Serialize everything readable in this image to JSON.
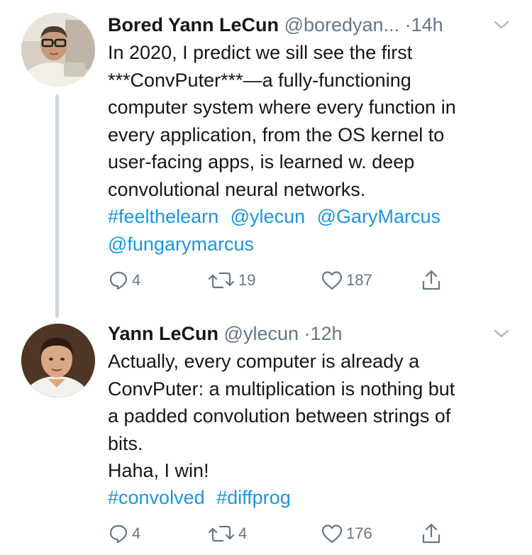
{
  "colors": {
    "link": "#1b95e0",
    "secondary": "#657786",
    "thread_line": "#ccd6dd"
  },
  "tweets": [
    {
      "name": "Bored Yann LeCun",
      "handle": "@boredyan...",
      "dot": "·",
      "time": "14h",
      "text": "In 2020, I predict we sill see the first\n***ConvPuter***—a fully-functioning\ncomputer system where every function in\nevery application, from the OS kernel to\nuser-facing apps, is learned w. deep\nconvolutional neural networks.",
      "tags": [
        "#feelthelearn",
        "@ylecun",
        "@GaryMarcus",
        "@fungarymarcus"
      ],
      "replies": "4",
      "retweets": "19",
      "likes": "187",
      "icons": [
        "reply-icon",
        "retweet-icon",
        "like-icon",
        "share-icon",
        "chevron-down-icon"
      ]
    },
    {
      "name": "Yann LeCun",
      "handle": "@ylecun",
      "dot": "·",
      "time": "12h",
      "text": "Actually, every computer is already a\nConvPuter: a multiplication is nothing but\na padded convolution between strings of\nbits.\nHaha, I win!",
      "tags": [
        "#convolved",
        "#diffprog"
      ],
      "replies": "4",
      "retweets": "4",
      "likes": "176",
      "icons": [
        "reply-icon",
        "retweet-icon",
        "like-icon",
        "share-icon",
        "chevron-down-icon"
      ]
    }
  ]
}
